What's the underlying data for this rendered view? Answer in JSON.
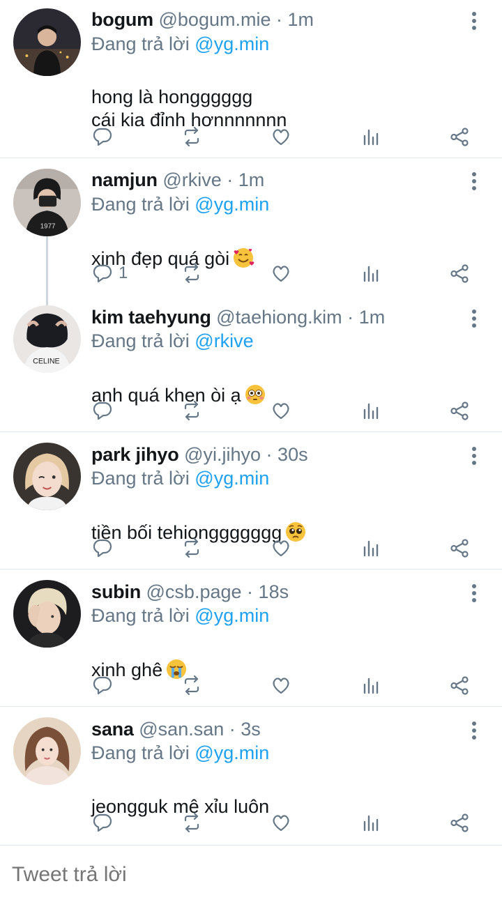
{
  "reply_prefix": "Đang trả lời",
  "dot": "·",
  "tweets": [
    {
      "name": "bogum",
      "handle": "@bogum.mie",
      "time": "1m",
      "reply_to": "@yg.min",
      "text": "hong là hongggggg\ncái kia đỉnh hơnnnnnnn",
      "emoji": "",
      "reply_count": ""
    },
    {
      "name": "namjun",
      "handle": "@rkive",
      "time": "1m",
      "reply_to": "@yg.min",
      "text": "xinh đẹp quá gòi",
      "emoji": "smiling-hearts-emoji",
      "reply_count": "1"
    },
    {
      "name": "kim taehyung",
      "handle": "@taehiong.kim",
      "time": "1m",
      "reply_to": "@rkive",
      "text": "anh quá khen òi ạ",
      "emoji": "flushed-emoji",
      "reply_count": ""
    },
    {
      "name": "park jihyo",
      "handle": "@yi.jihyo",
      "time": "30s",
      "reply_to": "@yg.min",
      "text": "tiền bối tehionggggggg",
      "emoji": "pleading-emoji",
      "reply_count": ""
    },
    {
      "name": "subin",
      "handle": "@csb.page",
      "time": "18s",
      "reply_to": "@yg.min",
      "text": "xinh ghê",
      "emoji": "crying-emoji",
      "reply_count": ""
    },
    {
      "name": "sana",
      "handle": "@san.san",
      "time": "3s",
      "reply_to": "@yg.min",
      "text": "jeongguk mê xỉu luôn",
      "emoji": "",
      "reply_count": ""
    }
  ],
  "composer": {
    "placeholder": "Tweet trả lời"
  },
  "colors": {
    "accent": "#1da1f2",
    "muted": "#657786",
    "icon": "#657786",
    "separator": "#e1e8ed"
  }
}
